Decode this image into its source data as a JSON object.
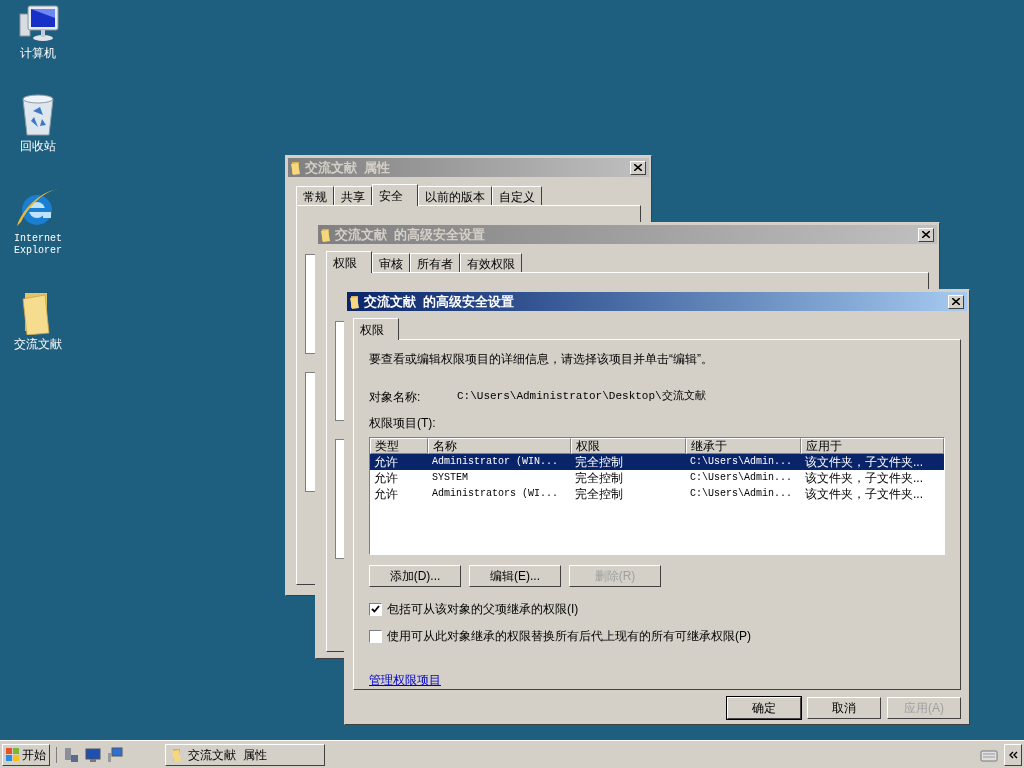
{
  "desktop_icons": [
    {
      "kind": "computer",
      "label": "计算机"
    },
    {
      "kind": "recycle",
      "label": "回收站"
    },
    {
      "kind": "browser",
      "label": "Internet Explorer"
    },
    {
      "kind": "folder",
      "label": "交流文献"
    }
  ],
  "back_windows": [
    {
      "title": "交流文献  属性",
      "tabs": [
        {
          "label": "常规",
          "selected": false
        },
        {
          "label": "共享",
          "selected": false
        },
        {
          "label": "安全",
          "selected": true
        },
        {
          "label": "以前的版本",
          "selected": false
        },
        {
          "label": "自定义",
          "selected": false
        }
      ]
    },
    {
      "title": "交流文献  的高级安全设置",
      "tabs": [
        {
          "label": "权限",
          "selected": true
        },
        {
          "label": "审核",
          "selected": false
        },
        {
          "label": "所有者",
          "selected": false
        },
        {
          "label": "有效权限",
          "selected": false
        }
      ]
    }
  ],
  "dialog": {
    "title": "交流文献  的高级安全设置",
    "tabs": [
      {
        "label": "权限",
        "selected": true
      }
    ],
    "instruction": "要查看或编辑权限项目的详细信息，请选择该项目并单击“编辑”。",
    "object_label": "对象名称:",
    "object_value": "C:\\Users\\Administrator\\Desktop\\交流文献",
    "entries_label": "权限项目(T):",
    "columns": [
      "类型",
      "名称",
      "权限",
      "继承于",
      "应用于"
    ],
    "rows": [
      {
        "cells": [
          "允许",
          "Administrator (WIN...",
          "完全控制",
          "C:\\Users\\Admin...",
          "该文件夹，子文件夹..."
        ],
        "selected": true
      },
      {
        "cells": [
          "允许",
          "SYSTEM",
          "完全控制",
          "C:\\Users\\Admin...",
          "该文件夹，子文件夹..."
        ],
        "selected": false
      },
      {
        "cells": [
          "允许",
          "Administrators (WI...",
          "完全控制",
          "C:\\Users\\Admin...",
          "该文件夹，子文件夹..."
        ],
        "selected": false
      }
    ],
    "list_buttons": [
      {
        "label": "添加(D)...",
        "disabled": false
      },
      {
        "label": "编辑(E)...",
        "disabled": false
      },
      {
        "label": "删除(R)",
        "disabled": true
      }
    ],
    "checkboxes": [
      {
        "label": "包括可从该对象的父项继承的权限(I)",
        "checked": true
      },
      {
        "label": "使用可从此对象继承的权限替换所有后代上现有的所有可继承权限(P)",
        "checked": false
      }
    ],
    "link": "管理权限项目",
    "buttons": [
      {
        "label": "确定",
        "disabled": false,
        "default": true
      },
      {
        "label": "取消",
        "disabled": false,
        "default": false
      },
      {
        "label": "应用(A)",
        "disabled": true,
        "default": false
      }
    ]
  },
  "taskbar": {
    "start": "开始",
    "tasks": [
      {
        "label": "交流文献  属性",
        "selected": false
      }
    ]
  }
}
